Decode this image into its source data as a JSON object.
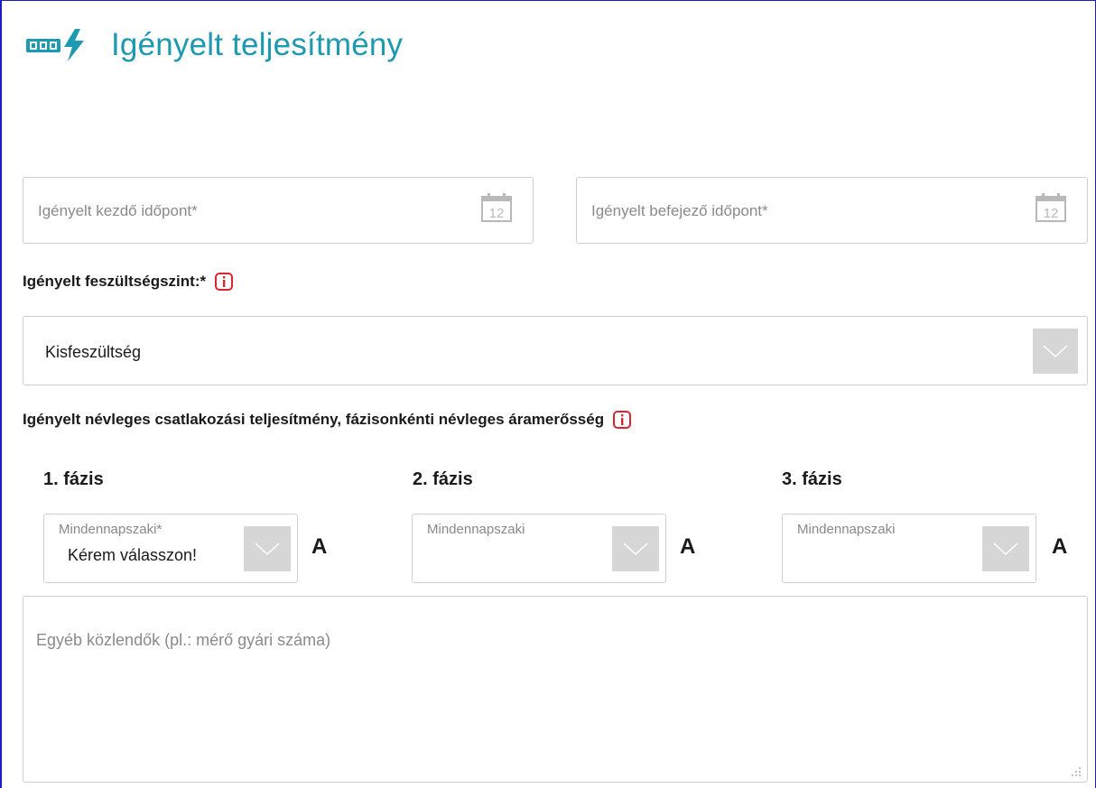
{
  "header": {
    "title": "Igényelt teljesítmény",
    "logo_icon": "meter-lightning-icon",
    "title_color": "#1e9ab0"
  },
  "dates": {
    "start_placeholder": "Igényelt kezdő időpont*",
    "end_placeholder": "Igényelt befejező időpont*",
    "calendar_icon_text": "12"
  },
  "voltage": {
    "label": "Igényelt feszültségszint:*",
    "value": "Kisfeszültség"
  },
  "power": {
    "label": "Igényelt névleges csatlakozási teljesítmény, fázisonkénti névleges áramerősség",
    "unit": "A",
    "phases": [
      {
        "label": "1. fázis",
        "field_label": "Mindennapszaki*",
        "value": "Kérem válasszon!"
      },
      {
        "label": "2. fázis",
        "field_label": "Mindennapszaki",
        "value": ""
      },
      {
        "label": "3. fázis",
        "field_label": "Mindennapszaki",
        "value": ""
      }
    ]
  },
  "notes": {
    "placeholder": "Egyéb közlendők (pl.: mérő gyári száma)"
  },
  "colors": {
    "info_red": "#d9262e",
    "accent": "#1e9ab0"
  }
}
